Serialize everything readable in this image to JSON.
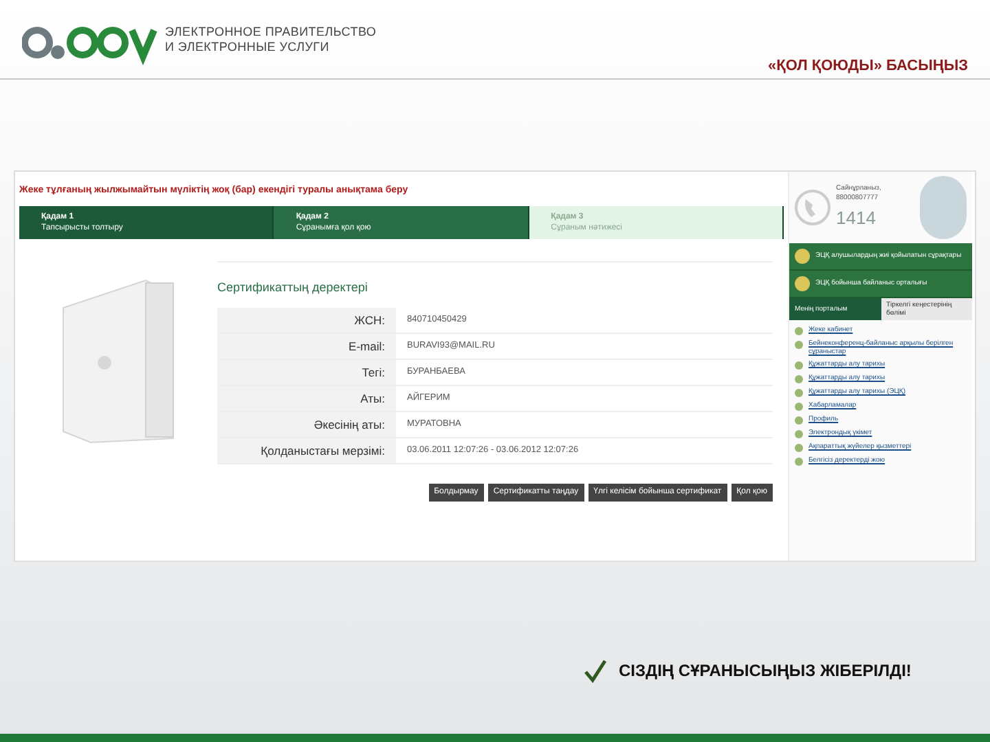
{
  "header": {
    "subtitle_lines": [
      "ЭЛЕКТРОННОЕ ПРАВИТЕЛЬСТВО",
      "И ЭЛЕКТРОННЫЕ УСЛУГИ"
    ],
    "slide_title": "«ҚОЛ ҚОЮДЫ» БАСЫҢЫЗ"
  },
  "page": {
    "title": "Жеке тұлғаның жылжымайтын мүліктің жоқ (бар) екендігі туралы анықтама беру",
    "steps": [
      {
        "label": "Қадам 1",
        "sub": "Тапсырысты толтыру",
        "kind": "done"
      },
      {
        "label": "Қадам 2",
        "sub": "Сұранымға қол қою",
        "kind": "current"
      },
      {
        "label": "Қадам 3",
        "sub": "Сұраным нәтижесі",
        "kind": "todo"
      }
    ],
    "section_title": "Сертификаттың деректері",
    "fields": [
      {
        "label": "ЖСН:",
        "value": "840710450429"
      },
      {
        "label": "E-mail:",
        "value": "BURAVI93@MAIL.RU"
      },
      {
        "label": "Тегі:",
        "value": "БУРАНБАЕВА"
      },
      {
        "label": "Аты:",
        "value": "АЙГЕРИМ"
      },
      {
        "label": "Әкесінің аты:",
        "value": "МУРАТОВНА"
      },
      {
        "label": "Қолданыстағы мерзімі:",
        "value": "03.06.2011 12:07:26 - 03.06.2012 12:07:26"
      }
    ],
    "buttons": [
      "Болдырмау",
      "Сертификатты таңдау",
      "Үлгі келісім бойынша сертификат",
      "Қол қою"
    ]
  },
  "sidebar": {
    "call_center": {
      "caption": "Сайнұрланыз,",
      "phone": "88000807777",
      "number": "1414"
    },
    "banners": [
      "ЭЦҚ алушылардың жиі қойылатын сұрақтары",
      "ЭЦҚ бойынша байланыс орталығы"
    ],
    "tabs": [
      {
        "label": "Менің порталым",
        "selected": true
      },
      {
        "label": "Тіркелгі кеңестерінің бөлімі",
        "selected": false
      }
    ],
    "links": [
      "Жеке кабинет",
      "Бейнеконференц-байланыс арқылы берілген сұраныстар",
      "Құжаттарды алу тарихы",
      "Құжаттарды алу тарихы",
      "Құжаттарды алу тарихы (ЭЦҚ)",
      "Хабарламалар",
      "Профиль",
      "Электрондық үкімет",
      "Ақпараттық жүйелер қызметтері",
      "Белгісіз деректерді жою"
    ]
  },
  "message": "СІЗДІҢ СҰРАНЫСЫҢЫЗ ЖІБЕРІЛДІ!"
}
